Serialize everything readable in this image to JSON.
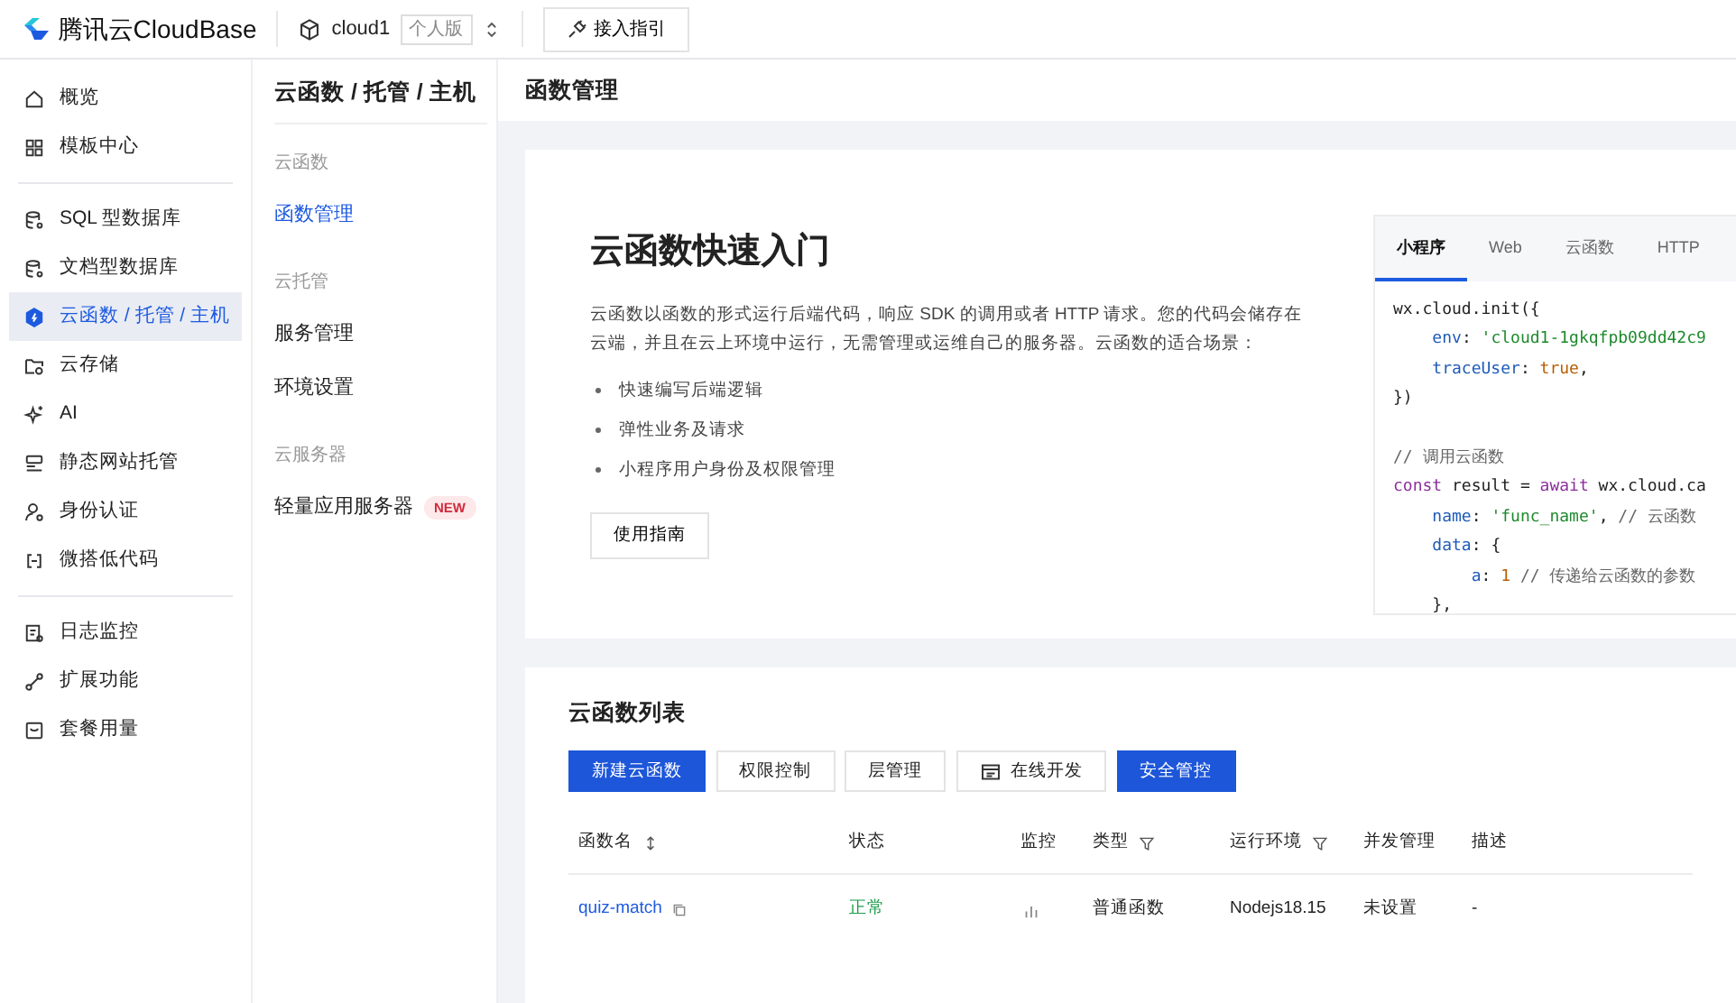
{
  "header": {
    "brand": "腾讯云CloudBase",
    "env_name": "cloud1",
    "env_badge": "个人版",
    "guide_button": "接入指引"
  },
  "sidebar": {
    "groups": [
      [
        {
          "label": "概览",
          "selected": false
        },
        {
          "label": "模板中心",
          "selected": false
        }
      ],
      [
        {
          "label": "SQL 型数据库",
          "selected": false
        },
        {
          "label": "文档型数据库",
          "selected": false
        },
        {
          "label": "云函数 / 托管 / 主机",
          "selected": true
        },
        {
          "label": "云存储",
          "selected": false
        },
        {
          "label": "AI",
          "selected": false
        },
        {
          "label": "静态网站托管",
          "selected": false
        },
        {
          "label": "身份认证",
          "selected": false
        },
        {
          "label": "微搭低代码",
          "selected": false
        }
      ],
      [
        {
          "label": "日志监控",
          "selected": false
        },
        {
          "label": "扩展功能",
          "selected": false
        },
        {
          "label": "套餐用量",
          "selected": false
        }
      ]
    ]
  },
  "subnav": {
    "title": "云函数 / 托管 / 主机",
    "sections": [
      {
        "heading": "云函数",
        "items": [
          {
            "label": "函数管理",
            "selected": true
          }
        ]
      },
      {
        "heading": "云托管",
        "items": [
          {
            "label": "服务管理",
            "selected": false
          },
          {
            "label": "环境设置",
            "selected": false
          }
        ]
      },
      {
        "heading": "云服务器",
        "items": [
          {
            "label": "轻量应用服务器",
            "selected": false,
            "badge": "NEW"
          }
        ]
      }
    ]
  },
  "page_title": "函数管理",
  "quickstart": {
    "title": "云函数快速入门",
    "description": "云函数以函数的形式运行后端代码，响应 SDK 的调用或者 HTTP 请求。您的代码会储存在云端，并且在云上环境中运行，无需管理或运维自己的服务器。云函数的适合场景：",
    "bullets": [
      "快速编写后端逻辑",
      "弹性业务及请求",
      "小程序用户身份及权限管理"
    ],
    "button": "使用指南",
    "code_tabs": [
      {
        "label": "小程序",
        "selected": true
      },
      {
        "label": "Web",
        "selected": false
      },
      {
        "label": "云函数",
        "selected": false
      },
      {
        "label": "HTTP",
        "selected": false
      }
    ],
    "code_blocks": [
      [
        [
          {
            "t": "wx.cloud.init({",
            "kind": "plain"
          }
        ],
        [
          {
            "t": "    env",
            "kind": "key"
          },
          {
            "t": ": ",
            "kind": "plain"
          },
          {
            "t": "'cloud1-1gkqfpb09dd42c9",
            "kind": "str"
          }
        ],
        [
          {
            "t": "    traceUser",
            "kind": "key"
          },
          {
            "t": ": ",
            "kind": "plain"
          },
          {
            "t": "true",
            "kind": "lit"
          },
          {
            "t": ",",
            "kind": "plain"
          }
        ],
        [
          {
            "t": "})",
            "kind": "plain"
          }
        ]
      ],
      [
        [
          {
            "t": "// 调用云函数",
            "kind": "comment"
          }
        ],
        [
          {
            "t": "const",
            "kind": "kw"
          },
          {
            "t": " result = ",
            "kind": "plain"
          },
          {
            "t": "await",
            "kind": "kw"
          },
          {
            "t": " wx.cloud.ca",
            "kind": "plain"
          }
        ],
        [
          {
            "t": "    name",
            "kind": "key"
          },
          {
            "t": ": ",
            "kind": "plain"
          },
          {
            "t": "'func_name'",
            "kind": "str"
          },
          {
            "t": ", ",
            "kind": "plain"
          },
          {
            "t": "// 云函数",
            "kind": "comment"
          }
        ],
        [
          {
            "t": "    data",
            "kind": "key"
          },
          {
            "t": ": {",
            "kind": "plain"
          }
        ],
        [
          {
            "t": "        a",
            "kind": "key"
          },
          {
            "t": ": ",
            "kind": "plain"
          },
          {
            "t": "1",
            "kind": "lit"
          },
          {
            "t": " // 传递给云函数的参数",
            "kind": "comment"
          }
        ],
        [
          {
            "t": "    },",
            "kind": "plain"
          }
        ]
      ]
    ]
  },
  "functions": {
    "title": "云函数列表",
    "buttons": [
      {
        "label": "新建云函数",
        "kind": "primary"
      },
      {
        "label": "权限控制",
        "kind": "default"
      },
      {
        "label": "层管理",
        "kind": "default"
      },
      {
        "label": "在线开发",
        "kind": "icon"
      },
      {
        "label": "安全管控",
        "kind": "primary"
      }
    ],
    "columns": [
      {
        "label": "函数名"
      },
      {
        "label": "状态"
      },
      {
        "label": "监控"
      },
      {
        "label": "类型"
      },
      {
        "label": "运行环境"
      },
      {
        "label": "并发管理"
      },
      {
        "label": "描述"
      }
    ],
    "rows": [
      {
        "name": "quiz-match",
        "status": "正常",
        "type": "普通函数",
        "runtime": "Nodejs18.15",
        "concurrency": "未设置",
        "description": "-"
      }
    ]
  }
}
